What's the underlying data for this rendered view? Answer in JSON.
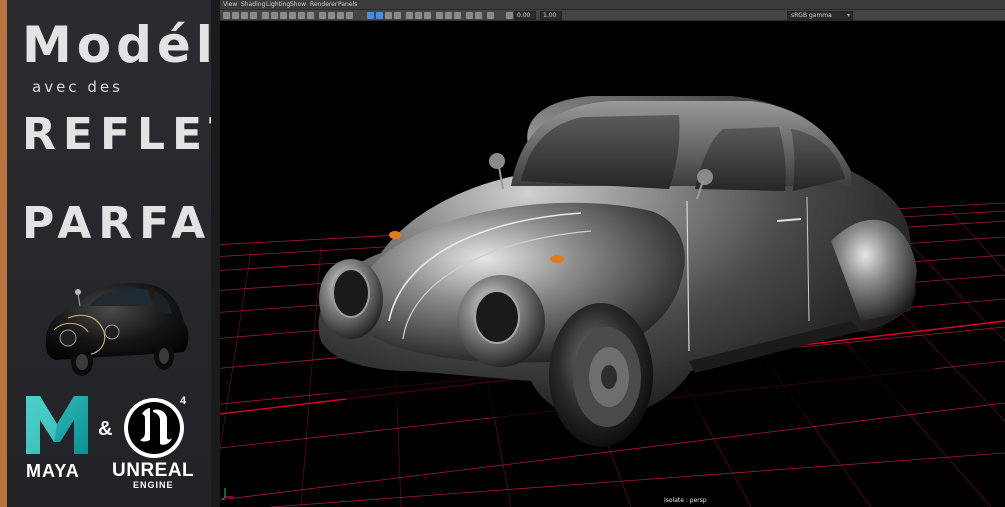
{
  "promo": {
    "title_line1": "Modéliser",
    "title_line2": "avec des",
    "title_line3": "REFLETS",
    "title_line4": "PARFAITS",
    "amp": "&",
    "maya_label": "MAYA",
    "unreal_label": "UNREAL",
    "unreal_sub": "ENGINE",
    "ue_badge": "4",
    "accent_color": "#b8743f",
    "maya_color": "#19a6a6"
  },
  "viewport": {
    "menu": [
      "View",
      "Shading",
      "Lighting",
      "Show",
      "Renderer",
      "Panels"
    ],
    "toolbar": {
      "field1_value": "0.00",
      "field2_value": "1.00",
      "color_space": "sRGB gamma"
    },
    "hud_label": "Isolate : persp",
    "grid_color": "#e0204a"
  }
}
